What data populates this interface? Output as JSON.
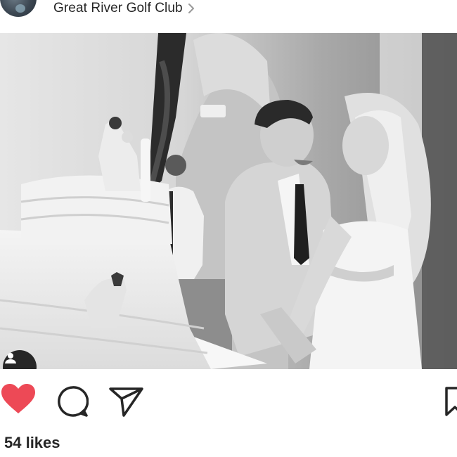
{
  "post": {
    "location": "Great River Golf Club",
    "likes_text": "54 likes",
    "liked": true
  },
  "colors": {
    "like_red": "#ed4956",
    "text": "#262626"
  },
  "icons": {
    "location_chevron": "chevron-right-icon",
    "like": "heart-icon",
    "comment": "comment-bubble-icon",
    "share": "paper-plane-icon",
    "save": "bookmark-icon",
    "tags": "user-tag-icon"
  }
}
